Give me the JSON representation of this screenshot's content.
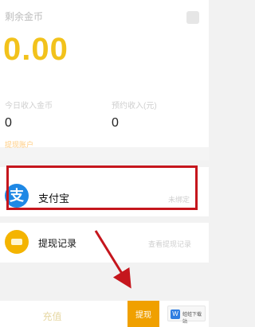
{
  "header": {
    "balance_label": "剩余金币",
    "balance_amount": "0.00"
  },
  "stats": [
    {
      "label": "今日收入金币",
      "value": "0"
    },
    {
      "label": "预约收入(元)",
      "value": "0"
    }
  ],
  "section": {
    "title": "提现账户"
  },
  "rows": {
    "alipay": {
      "label": "支付宝",
      "status": "未绑定",
      "icon_text": "支"
    },
    "records": {
      "label": "提现记录",
      "status": "查看提现记录"
    }
  },
  "bottom": {
    "recharge_label": "充值",
    "withdraw_label": "提现"
  },
  "watermark": {
    "icon_text": "W",
    "text": "蛙蛙下载站"
  },
  "colors": {
    "accent_gold": "#f2c21b",
    "highlight_red": "#c5161d",
    "alipay_blue": "#1e88e5",
    "orange": "#f0a000"
  }
}
